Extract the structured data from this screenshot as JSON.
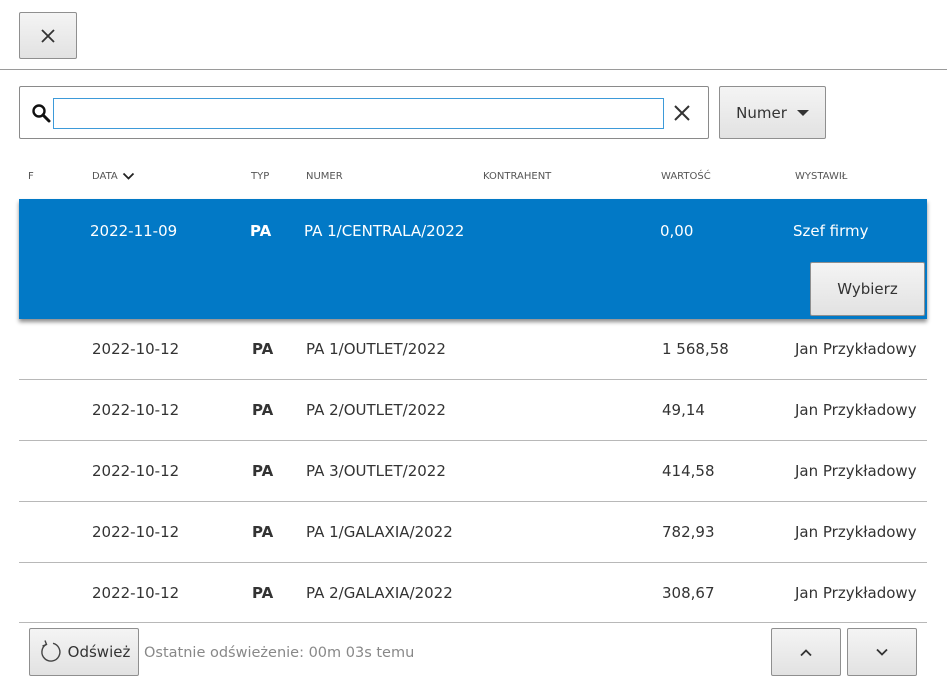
{
  "search": {
    "value": "",
    "placeholder": ""
  },
  "filter_button": {
    "label": "Numer"
  },
  "columns": {
    "f": "F",
    "data": "DATA",
    "typ": "TYP",
    "numer": "NUMER",
    "kontrahent": "KONTRAHENT",
    "wartosc": "WARTOŚĆ",
    "wystawil": "WYSTAWIŁ"
  },
  "rows": [
    {
      "data": "2022-11-09",
      "typ": "PA",
      "numer": "PA 1/CENTRALA/2022",
      "kontrahent": "",
      "wartosc": "0,00",
      "wystawil": "Szef firmy"
    },
    {
      "data": "2022-10-12",
      "typ": "PA",
      "numer": "PA 1/OUTLET/2022",
      "kontrahent": "",
      "wartosc": "1 568,58",
      "wystawil": "Jan Przykładowy"
    },
    {
      "data": "2022-10-12",
      "typ": "PA",
      "numer": "PA 2/OUTLET/2022",
      "kontrahent": "",
      "wartosc": "49,14",
      "wystawil": "Jan Przykładowy"
    },
    {
      "data": "2022-10-12",
      "typ": "PA",
      "numer": "PA 3/OUTLET/2022",
      "kontrahent": "",
      "wartosc": "414,58",
      "wystawil": "Jan Przykładowy"
    },
    {
      "data": "2022-10-12",
      "typ": "PA",
      "numer": "PA 1/GALAXIA/2022",
      "kontrahent": "",
      "wartosc": "782,93",
      "wystawil": "Jan Przykładowy"
    },
    {
      "data": "2022-10-12",
      "typ": "PA",
      "numer": "PA 2/GALAXIA/2022",
      "kontrahent": "",
      "wartosc": "308,67",
      "wystawil": "Jan Przykładowy"
    }
  ],
  "select_button": {
    "label": "Wybierz"
  },
  "footer": {
    "refresh_label": "Odśwież",
    "refresh_status": "Ostatnie odświeżenie: 00m 03s temu"
  },
  "colors": {
    "selected_row": "#0279c6",
    "input_focus": "#3d9ad9"
  }
}
